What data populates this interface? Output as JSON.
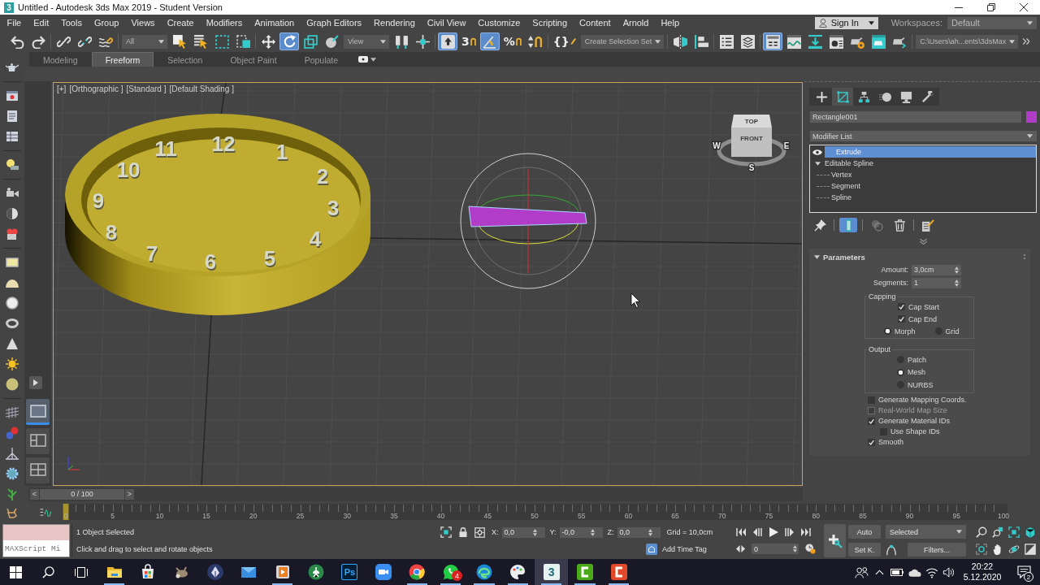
{
  "window": {
    "title": "Untitled - Autodesk 3ds Max 2019 - Student Version",
    "app_glyph": "3"
  },
  "menu_bar": {
    "items": [
      "File",
      "Edit",
      "Tools",
      "Group",
      "Views",
      "Create",
      "Modifiers",
      "Animation",
      "Graph Editors",
      "Rendering",
      "Civil View",
      "Customize",
      "Scripting",
      "Content",
      "Arnold",
      "Help"
    ],
    "sign_in": "Sign In",
    "workspaces_label": "Workspaces:",
    "workspace": "Default"
  },
  "main_toolbar": {
    "items": [
      {
        "kind": "tool",
        "active": false
      },
      {
        "kind": "tool",
        "active": false
      },
      {
        "kind": "tool",
        "active": false
      },
      {
        "kind": "tool",
        "active": false
      },
      {
        "kind": "tool",
        "active": false
      },
      {
        "kind": "dropdown",
        "value": "All"
      },
      {
        "kind": "tool",
        "active": false
      },
      {
        "kind": "tool",
        "active": false
      },
      {
        "kind": "tool",
        "active": false
      },
      {
        "kind": "tool",
        "active": false
      },
      {
        "kind": "tool",
        "active": false
      },
      {
        "kind": "tool",
        "active": true
      },
      {
        "kind": "tool",
        "active": false
      },
      {
        "kind": "tool",
        "active": false
      },
      {
        "kind": "dropdown",
        "value": "View"
      },
      {
        "kind": "tool",
        "active": false
      },
      {
        "kind": "tool",
        "active": false
      },
      {
        "kind": "tool",
        "active": true
      },
      {
        "kind": "tool",
        "active": false,
        "glyph": "3"
      },
      {
        "kind": "tool",
        "active": true
      },
      {
        "kind": "tool",
        "active": false,
        "glyph": "%"
      },
      {
        "kind": "tool",
        "active": false
      },
      {
        "kind": "tool",
        "active": false,
        "glyph": "{}"
      },
      {
        "kind": "dropdown",
        "value": "Create Selection Set"
      },
      {
        "kind": "tool",
        "active": false
      },
      {
        "kind": "tool",
        "active": false
      },
      {
        "kind": "tool",
        "active": false
      },
      {
        "kind": "tool",
        "active": false
      },
      {
        "kind": "tool",
        "active": true
      },
      {
        "kind": "tool",
        "active": false
      },
      {
        "kind": "tool",
        "active": false
      },
      {
        "kind": "tool",
        "active": false
      },
      {
        "kind": "tool",
        "active": false
      },
      {
        "kind": "tool",
        "active": false
      },
      {
        "kind": "tool",
        "active": false
      },
      {
        "kind": "dropdown",
        "value": "C:\\Users\\ah...ents\\3dsMax"
      },
      {
        "kind": "tool",
        "active": false
      }
    ]
  },
  "ribbon": {
    "tabs": [
      {
        "label": "Modeling",
        "selected": false
      },
      {
        "label": "Freeform",
        "selected": true
      },
      {
        "label": "Selection",
        "selected": false
      },
      {
        "label": "Object Paint",
        "selected": false
      },
      {
        "label": "Populate",
        "selected": false
      }
    ]
  },
  "viewport_layouts": [
    {
      "selected": true
    },
    {
      "selected": false
    },
    {
      "selected": false
    }
  ],
  "viewport": {
    "labels": [
      "[+]",
      "[Orthographic ]",
      "[Standard ]",
      "[Default Shading ]"
    ],
    "numerals": [
      "11",
      "12",
      "1",
      "10",
      "2",
      "9",
      "3",
      "8",
      "4",
      "7",
      "6",
      "5"
    ],
    "cube_faces": [
      "TOP",
      "FRONT"
    ],
    "compass": [
      "W",
      "E",
      "S"
    ]
  },
  "command_panel": {
    "tabs": [
      {
        "selected": false
      },
      {
        "selected": true
      },
      {
        "selected": false
      },
      {
        "selected": false
      },
      {
        "selected": false
      },
      {
        "selected": false
      }
    ],
    "object_name": "Rectangle001",
    "modifier_list": "Modifier List",
    "stack": [
      {
        "kind": "modifier",
        "label": "Extrude",
        "selected": true
      },
      {
        "kind": "base",
        "label": "Editable Spline",
        "selected": false,
        "expanded": true,
        "children": [
          {
            "label": "Vertex",
            "selected": false
          },
          {
            "label": "Segment",
            "selected": false
          },
          {
            "label": "Spline",
            "selected": false
          }
        ]
      }
    ],
    "stack_tools": [
      {
        "active": false
      },
      {
        "active": true
      },
      {
        "active": false
      },
      {
        "active": false
      },
      {
        "active": false
      }
    ],
    "rollout": {
      "title": "Parameters",
      "expanded": true,
      "fields": [
        {
          "label": "Amount:",
          "value": "3,0cm"
        },
        {
          "label": "Segments:",
          "value": "1"
        }
      ],
      "groups": [
        {
          "label": "Capping",
          "items": [
            {
              "kind": "check",
              "label": "Cap Start",
              "checked": true
            },
            {
              "kind": "check",
              "label": "Cap End",
              "checked": true
            },
            {
              "kind": "radio_row",
              "options": [
                {
                  "label": "Morph",
                  "selected": true
                },
                {
                  "label": "Grid",
                  "selected": false
                }
              ]
            }
          ]
        },
        {
          "label": "Output",
          "items": [
            {
              "kind": "radio_column",
              "options": [
                {
                  "label": "Patch",
                  "selected": false
                },
                {
                  "label": "Mesh",
                  "selected": true
                },
                {
                  "label": "NURBS",
                  "selected": false
                }
              ]
            }
          ]
        }
      ],
      "options": [
        {
          "label": "Generate Mapping Coords.",
          "checked": false,
          "disabled": false
        },
        {
          "label": "Real-World Map Size",
          "checked": false,
          "disabled": true
        },
        {
          "label": "Generate Material IDs",
          "checked": true,
          "disabled": false,
          "children": [
            {
              "label": "Use Shape IDs",
              "checked": false,
              "disabled": false
            }
          ]
        },
        {
          "label": "Smooth",
          "checked": true,
          "disabled": false
        }
      ]
    }
  },
  "time_slider": {
    "prev": "<",
    "label": "0 / 100",
    "next": ">",
    "level": 0
  },
  "track_bar": {
    "ticks": [
      "0",
      "5",
      "10",
      "15",
      "20",
      "25",
      "30",
      "35",
      "40",
      "45",
      "50",
      "55",
      "60",
      "65",
      "70",
      "75",
      "80",
      "85",
      "90",
      "95",
      "100"
    ],
    "level": 0
  },
  "status_bar": {
    "listener": "MAXScript Mi",
    "selection": "1 Object Selected",
    "prompt": "Click and drag to select and rotate objects",
    "coordinates": [
      {
        "axis": "X:",
        "value": "0,0"
      },
      {
        "axis": "Y:",
        "value": "-0,0"
      },
      {
        "axis": "Z:",
        "value": "0,0"
      }
    ],
    "grid": "Grid = 10,0cm",
    "time_tag": "Add Time Tag",
    "frame": "0",
    "auto_key": "Auto",
    "set_key": "Set K.",
    "key_filter": "Selected",
    "filters": "Filters..."
  },
  "taskbar": {
    "apps": [
      {
        "kind": "folder",
        "running": true,
        "selected": false
      },
      {
        "kind": "store",
        "running": false,
        "selected": false
      },
      {
        "kind": "creature",
        "running": false,
        "selected": false
      },
      {
        "kind": "pen",
        "running": false,
        "selected": false
      },
      {
        "kind": "mail",
        "running": false,
        "selected": false
      },
      {
        "kind": "player",
        "running": true,
        "selected": false
      },
      {
        "kind": "robot",
        "running": false,
        "selected": false
      },
      {
        "kind": "editor",
        "glyph": "Ps",
        "running": false,
        "selected": false
      },
      {
        "kind": "camera",
        "running": false,
        "selected": false
      },
      {
        "kind": "browser",
        "running": true,
        "selected": false
      },
      {
        "kind": "chat",
        "badge": "4",
        "running": true,
        "selected": false
      },
      {
        "kind": "swirl",
        "running": true,
        "selected": false
      },
      {
        "kind": "palette",
        "running": true,
        "selected": false
      },
      {
        "kind": "modeler",
        "glyph": "3",
        "running": true,
        "selected": true
      },
      {
        "kind": "recorder",
        "color": "#4caa1a",
        "running": true,
        "selected": false
      },
      {
        "kind": "recorder",
        "color": "#e04a2a",
        "running": true,
        "selected": false
      }
    ],
    "time": "20:22",
    "date": "5.12.2020",
    "notifications": "2"
  }
}
